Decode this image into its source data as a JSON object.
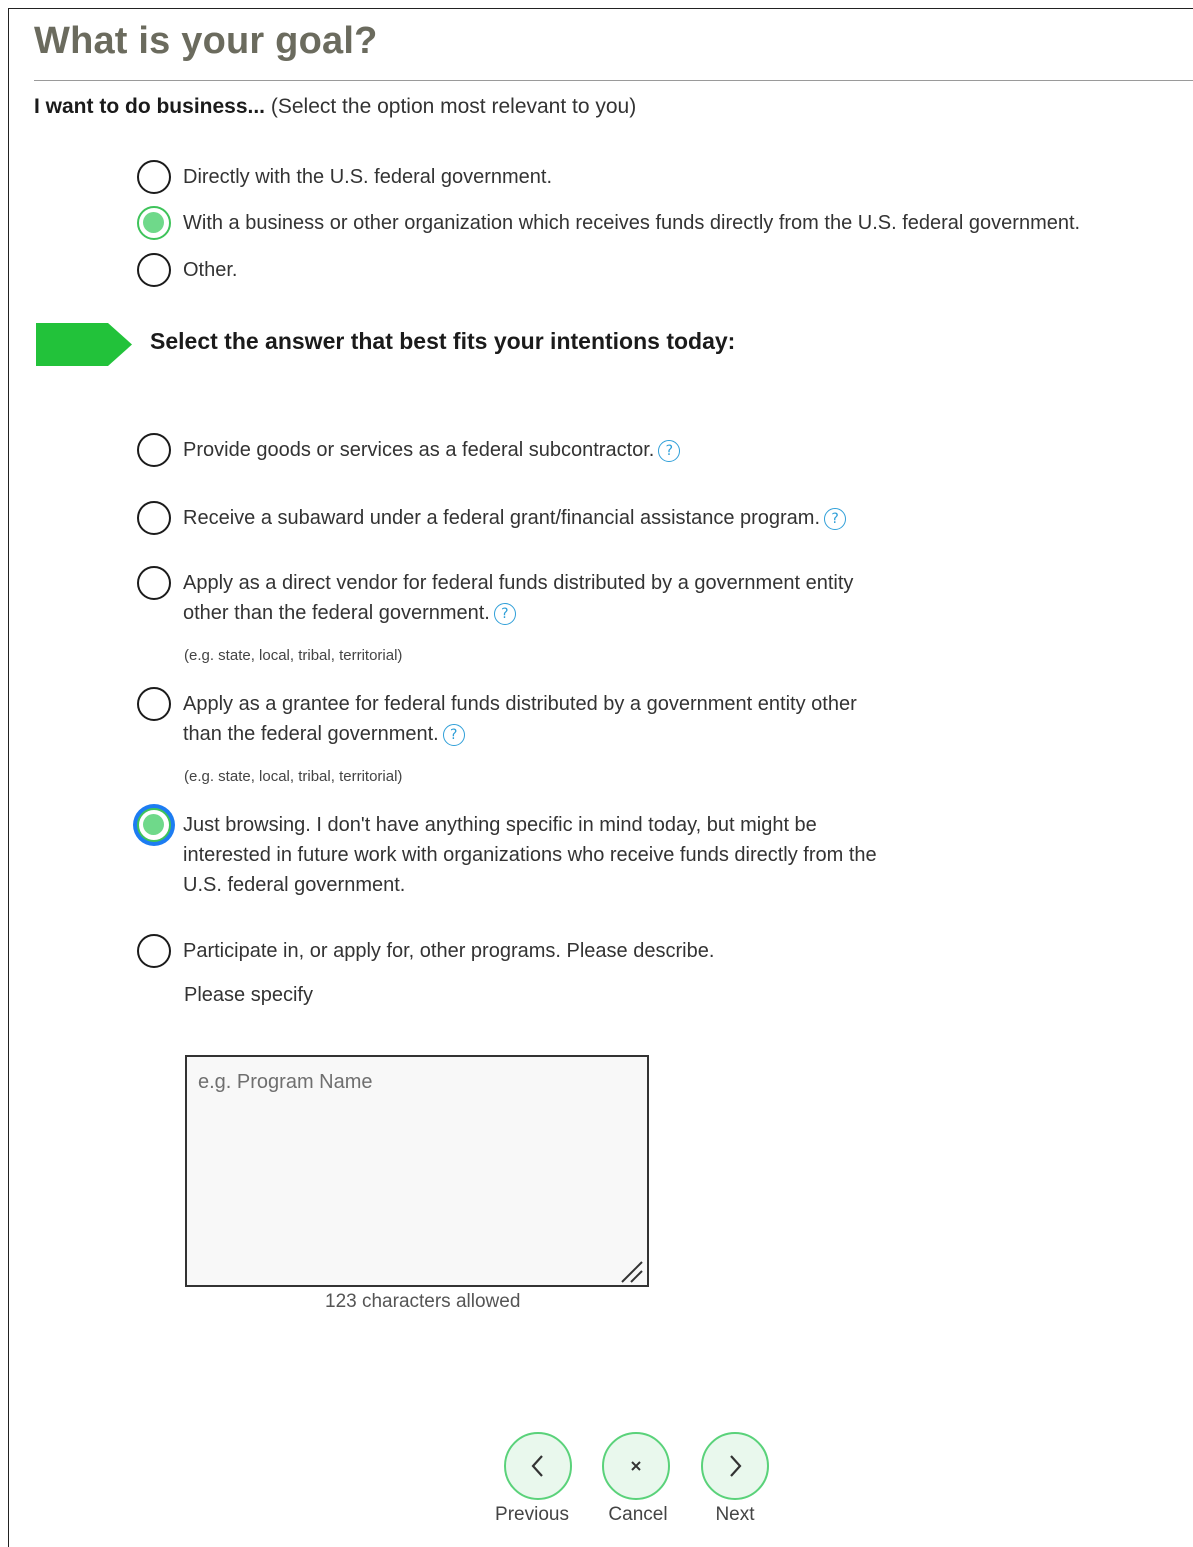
{
  "page": {
    "title": "What is your goal?",
    "question_bold": "I want to do business...",
    "question_rest": " (Select the option most relevant to you)"
  },
  "business_options": [
    {
      "label": "Directly with the U.S. federal government.",
      "selected": false
    },
    {
      "label": "With a business or other organization which receives funds directly from the U.S. federal government.",
      "selected": true
    },
    {
      "label": "Other.",
      "selected": false
    }
  ],
  "intentions": {
    "heading": "Select the answer that best fits your intentions today:",
    "options": [
      {
        "label": "Provide goods or services as a federal subcontractor.",
        "selected": false,
        "help_icon": "question-circle-icon"
      },
      {
        "label": "Receive a subaward under a federal grant/financial assistance program.",
        "selected": false,
        "help_icon": "question-circle-icon"
      },
      {
        "label_line1": "Apply as a direct vendor for federal funds distributed by a government entity",
        "label_line2": "other than the federal government.",
        "hint": "(e.g. state, local, tribal, territorial)",
        "selected": false,
        "help_icon": "question-circle-icon"
      },
      {
        "label_line1": "Apply as a grantee for federal funds distributed by a government entity other",
        "label_line2": "than the federal government.",
        "hint": "(e.g. state, local, tribal, territorial)",
        "selected": false,
        "help_icon": "question-circle-icon"
      },
      {
        "label_line1": "Just browsing. I don't have anything specific in mind today, but might be",
        "label_line2": "interested in future work with organizations who receive funds directly from the",
        "label_line3": "U.S. federal government.",
        "selected": true,
        "focused": true
      },
      {
        "label": "Participate in, or apply for, other programs. Please describe.",
        "selected": false
      }
    ]
  },
  "other_program": {
    "label": "Please specify",
    "placeholder": "e.g. Program Name",
    "value": "",
    "char_count": "123 characters allowed"
  },
  "navigation": {
    "previous_label": "Previous",
    "cancel_label": "Cancel",
    "next_label": "Next"
  },
  "colors": {
    "accent_green": "#3ec35a",
    "arrow_green": "#22c23a",
    "focus_blue": "#1d7cf2",
    "help_blue": "#2f9fd8",
    "title_gray": "#6b6b5e"
  }
}
